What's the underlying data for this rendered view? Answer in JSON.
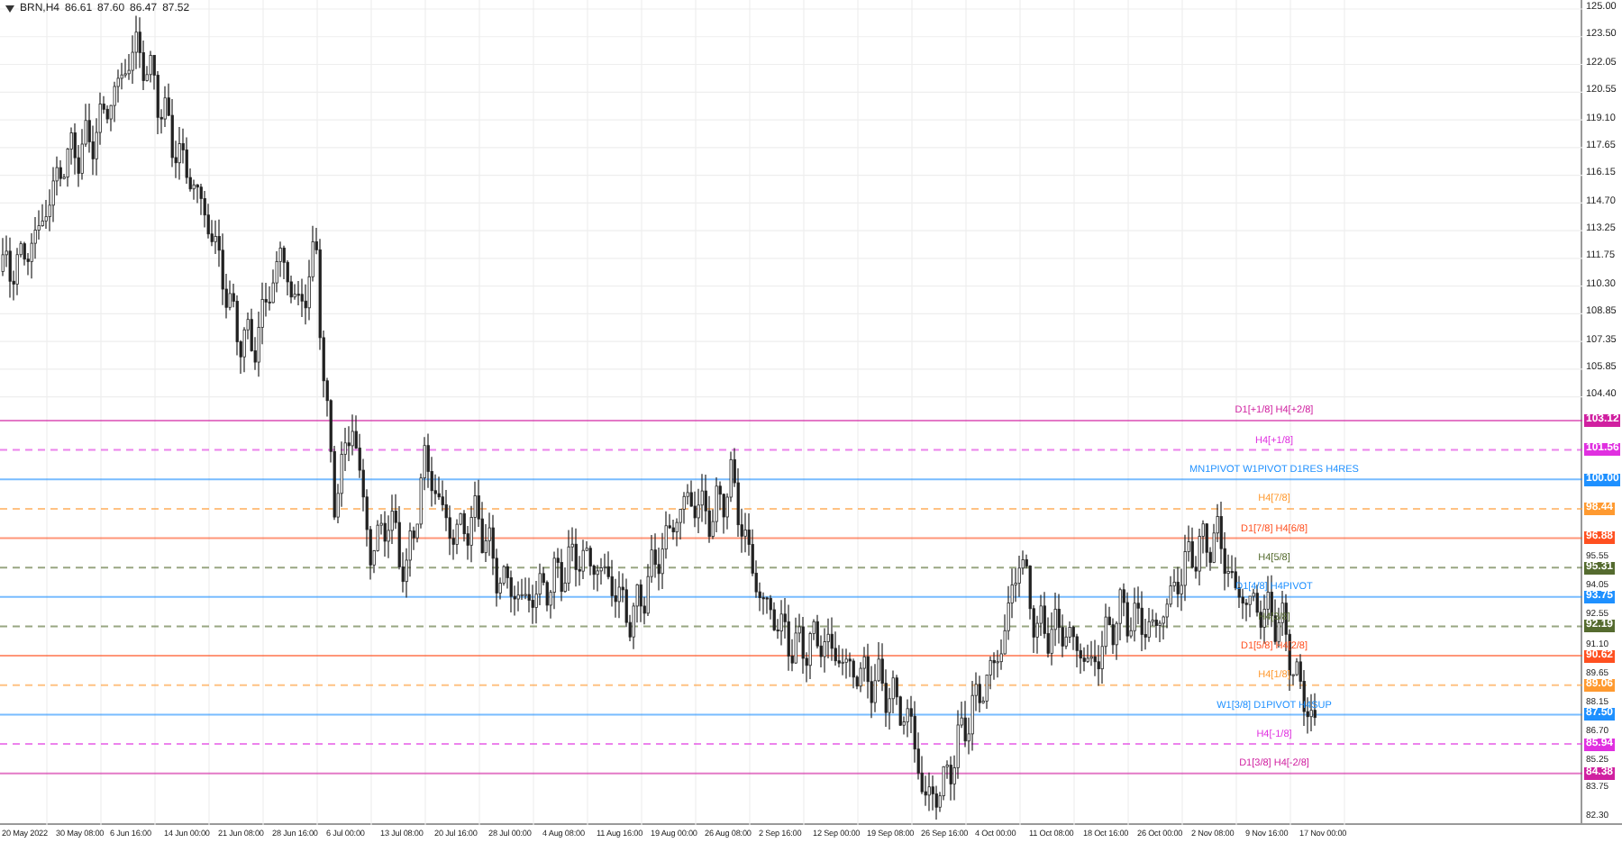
{
  "header": {
    "symbol": "BRN,H4",
    "ohlc": [
      "86.61",
      "87.60",
      "86.47",
      "87.52"
    ]
  },
  "price_axis": {
    "ticks_upper": [
      "125.00",
      "123.50",
      "122.05",
      "120.55",
      "119.10",
      "117.65",
      "116.15",
      "114.70",
      "113.25",
      "111.75",
      "110.30",
      "108.85",
      "107.35",
      "105.85",
      "104.40"
    ],
    "ticks_lower": [
      "95.55",
      "94.05",
      "92.55",
      "91.10",
      "89.65",
      "88.15",
      "86.70",
      "85.25",
      "83.75",
      "82.30"
    ]
  },
  "levels": [
    {
      "label": "D1[+1/8] H4[+2/8]",
      "tag": "103.12",
      "color": "#d020a0",
      "kind": "solid"
    },
    {
      "label": "H4[+1/8]",
      "tag": "101.56",
      "color": "#e030e0",
      "kind": "dashed"
    },
    {
      "label": "MN1PIVOT W1PIVOT D1RES H4RES",
      "tag": "100.00",
      "color": "#1e90ff",
      "kind": "solid"
    },
    {
      "label": "H4[7/8]",
      "tag": "98.44",
      "color": "#ff9a30",
      "kind": "dashed"
    },
    {
      "label": "D1[7/8] H4[6/8]",
      "tag": "96.88",
      "color": "#ff5020",
      "kind": "solid"
    },
    {
      "label": "H4[5/8]",
      "tag": "95.31",
      "color": "#556b2f",
      "kind": "dashed"
    },
    {
      "label": "D1[4/8] H4PIVOT",
      "tag": "93.75",
      "color": "#1e90ff",
      "kind": "solid"
    },
    {
      "label": "H4[3/8]",
      "tag": "92.19",
      "color": "#556b2f",
      "kind": "dashed"
    },
    {
      "label": "D1[5/8] H4[2/8]",
      "tag": "90.62",
      "color": "#ff5020",
      "kind": "solid"
    },
    {
      "label": "H4[1/8]",
      "tag": "89.06",
      "color": "#ff9a30",
      "kind": "dashed"
    },
    {
      "label": "W1[3/8] D1PIVOT H4SUP",
      "tag": "87.50",
      "color": "#1e90ff",
      "kind": "solid"
    },
    {
      "label": "H4[-1/8]",
      "tag": "85.94",
      "color": "#e030e0",
      "kind": "dashed"
    },
    {
      "label": "D1[3/8] H4[-2/8]",
      "tag": "84.38",
      "color": "#d020a0",
      "kind": "solid"
    }
  ],
  "time_axis": [
    "20 May 2022",
    "30 May 08:00",
    "6 Jun 16:00",
    "14 Jun 00:00",
    "21 Jun 08:00",
    "28 Jun 16:00",
    "6 Jul 00:00",
    "13 Jul 08:00",
    "20 Jul 16:00",
    "28 Jul 00:00",
    "4 Aug 08:00",
    "11 Aug 16:00",
    "19 Aug 00:00",
    "26 Aug 08:00",
    "2 Sep 16:00",
    "12 Sep 00:00",
    "19 Sep 08:00",
    "26 Sep 16:00",
    "4 Oct 00:00",
    "11 Oct 08:00",
    "18 Oct 16:00",
    "26 Oct 00:00",
    "2 Nov 08:00",
    "9 Nov 16:00",
    "17 Nov 00:00"
  ]
}
